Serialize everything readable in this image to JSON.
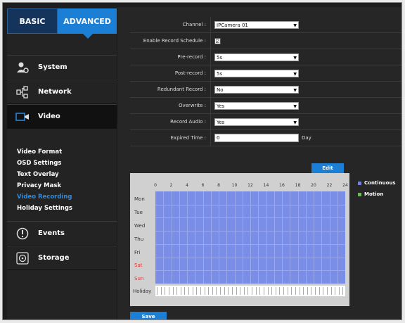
{
  "tabs": {
    "basic": "BASIC",
    "advanced": "ADVANCED"
  },
  "menu": [
    {
      "label": "System",
      "icon": "user-gear-icon"
    },
    {
      "label": "Network",
      "icon": "network-icon"
    },
    {
      "label": "Video",
      "icon": "video-camera-icon"
    },
    {
      "label": "Events",
      "icon": "alert-icon"
    },
    {
      "label": "Storage",
      "icon": "disk-icon"
    }
  ],
  "submenu": [
    "Video Format",
    "OSD Settings",
    "Text Overlay",
    "Privacy Mask",
    "Video Recording",
    "Holiday Settings"
  ],
  "submenu_selected": "Video Recording",
  "form": {
    "channel_label": "Channel :",
    "channel_value": "IPCamera 01",
    "enable_label": "Enable Record Schedule :",
    "enable_checked": "☑",
    "prerecord_label": "Pre-record :",
    "prerecord_value": "5s",
    "postrecord_label": "Post-record :",
    "postrecord_value": "5s",
    "redundant_label": "Redundant Record :",
    "redundant_value": "No",
    "overwrite_label": "Overwrite :",
    "overwrite_value": "Yes",
    "audio_label": "Record Audio :",
    "audio_value": "Yes",
    "expired_label": "Expired Time :",
    "expired_value": "0",
    "expired_unit": "Day"
  },
  "edit_button": "Edit",
  "save_button": "Save",
  "schedule": {
    "hours": [
      "0",
      "2",
      "4",
      "6",
      "8",
      "10",
      "12",
      "14",
      "16",
      "18",
      "20",
      "22",
      "24"
    ],
    "days": [
      "Mon",
      "Tue",
      "Wed",
      "Thu",
      "Fri",
      "Sat",
      "Sun"
    ],
    "holiday": "Holiday",
    "continuous_color": "#7a8ee8"
  },
  "legend": [
    {
      "label": "Continuous",
      "color": "#6f7fe6"
    },
    {
      "label": "Motion",
      "color": "#6cbd45"
    }
  ]
}
